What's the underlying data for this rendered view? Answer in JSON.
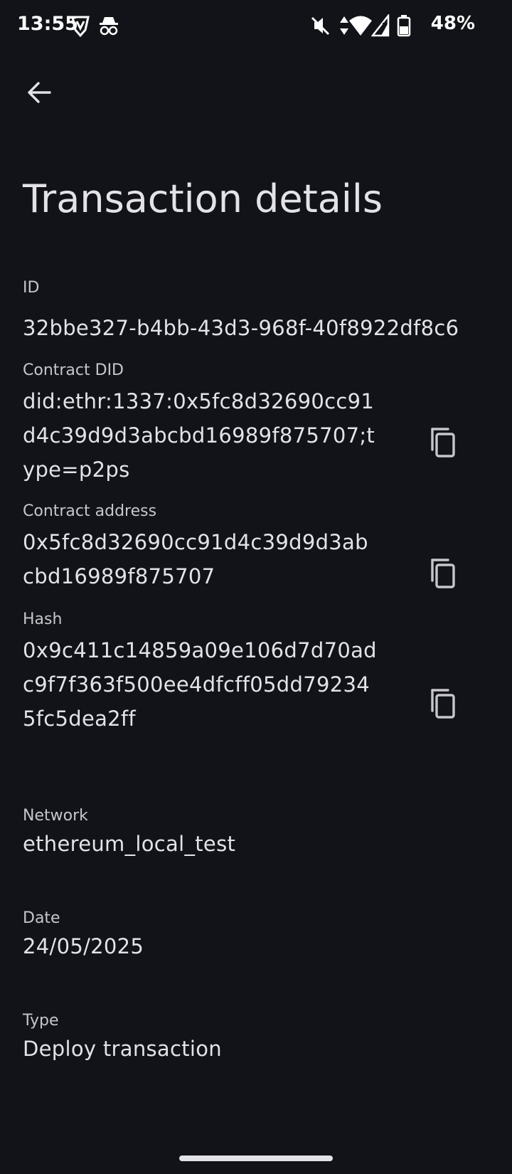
{
  "status_bar": {
    "time": "13:55",
    "battery": "48%"
  },
  "header": {
    "title": "Transaction details"
  },
  "fields": {
    "id": {
      "label": "ID",
      "value": "32bbe327-b4bb-43d3-968f-40f8922df8c6"
    },
    "contract_did": {
      "label": "Contract DID",
      "value": "did:ethr:1337:0x5fc8d32690cc91\nd4c39d9d3abcbd16989f875707;t\nype=p2ps"
    },
    "contract_address": {
      "label": "Contract address",
      "value": "0x5fc8d32690cc91d4c39d9d3ab\ncbd16989f875707"
    },
    "hash": {
      "label": "Hash",
      "value": "0x9c411c14859a09e106d7d70ad\nc9f7f363f500ee4dfcff05dd79234\n5fc5dea2ff"
    },
    "network": {
      "label": "Network",
      "value": "ethereum_local_test"
    },
    "date": {
      "label": "Date",
      "value": "24/05/2025"
    },
    "type": {
      "label": "Type",
      "value": "Deploy transaction"
    }
  },
  "icons": {
    "back": "arrow-left-icon",
    "copy": "content-copy-icon"
  }
}
